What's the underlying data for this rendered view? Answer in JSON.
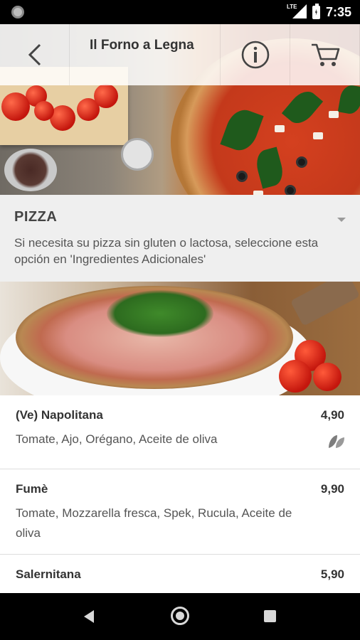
{
  "status_bar": {
    "time": "7:35",
    "network": "LTE",
    "icons": [
      "notification-dot-icon",
      "lte-signal-icon",
      "battery-charging-icon"
    ]
  },
  "header": {
    "title": "Il Forno a Legna",
    "icons": [
      "back-arrow-icon",
      "info-icon",
      "cart-icon"
    ]
  },
  "category": {
    "title": "PIZZA",
    "description": "Si necesita su pizza sin gluten o lactosa, seleccione esta opción en 'Ingredientes Adicionales'",
    "icon": "caret-down-icon"
  },
  "menu_items": [
    {
      "name": "(Ve) Napolitana",
      "price": "4,90",
      "description": "Tomate, Ajo, Orégano, Aceite de oliva",
      "icon": "vegan-leaf-icon"
    },
    {
      "name": "Fumè",
      "price": "9,90",
      "description": "Tomate, Mozzarella fresca, Spek, Rucula, Aceite de oliva"
    },
    {
      "name": "Salernitana",
      "price": "5,90",
      "description": ""
    }
  ],
  "nav_bar": {
    "icons": [
      "nav-back-icon",
      "nav-home-icon",
      "nav-recents-icon"
    ]
  },
  "colors": {
    "header_overlay": "#ffffffd9",
    "category_bg": "#efefef",
    "text_primary": "#333333",
    "text_secondary": "#555555"
  }
}
